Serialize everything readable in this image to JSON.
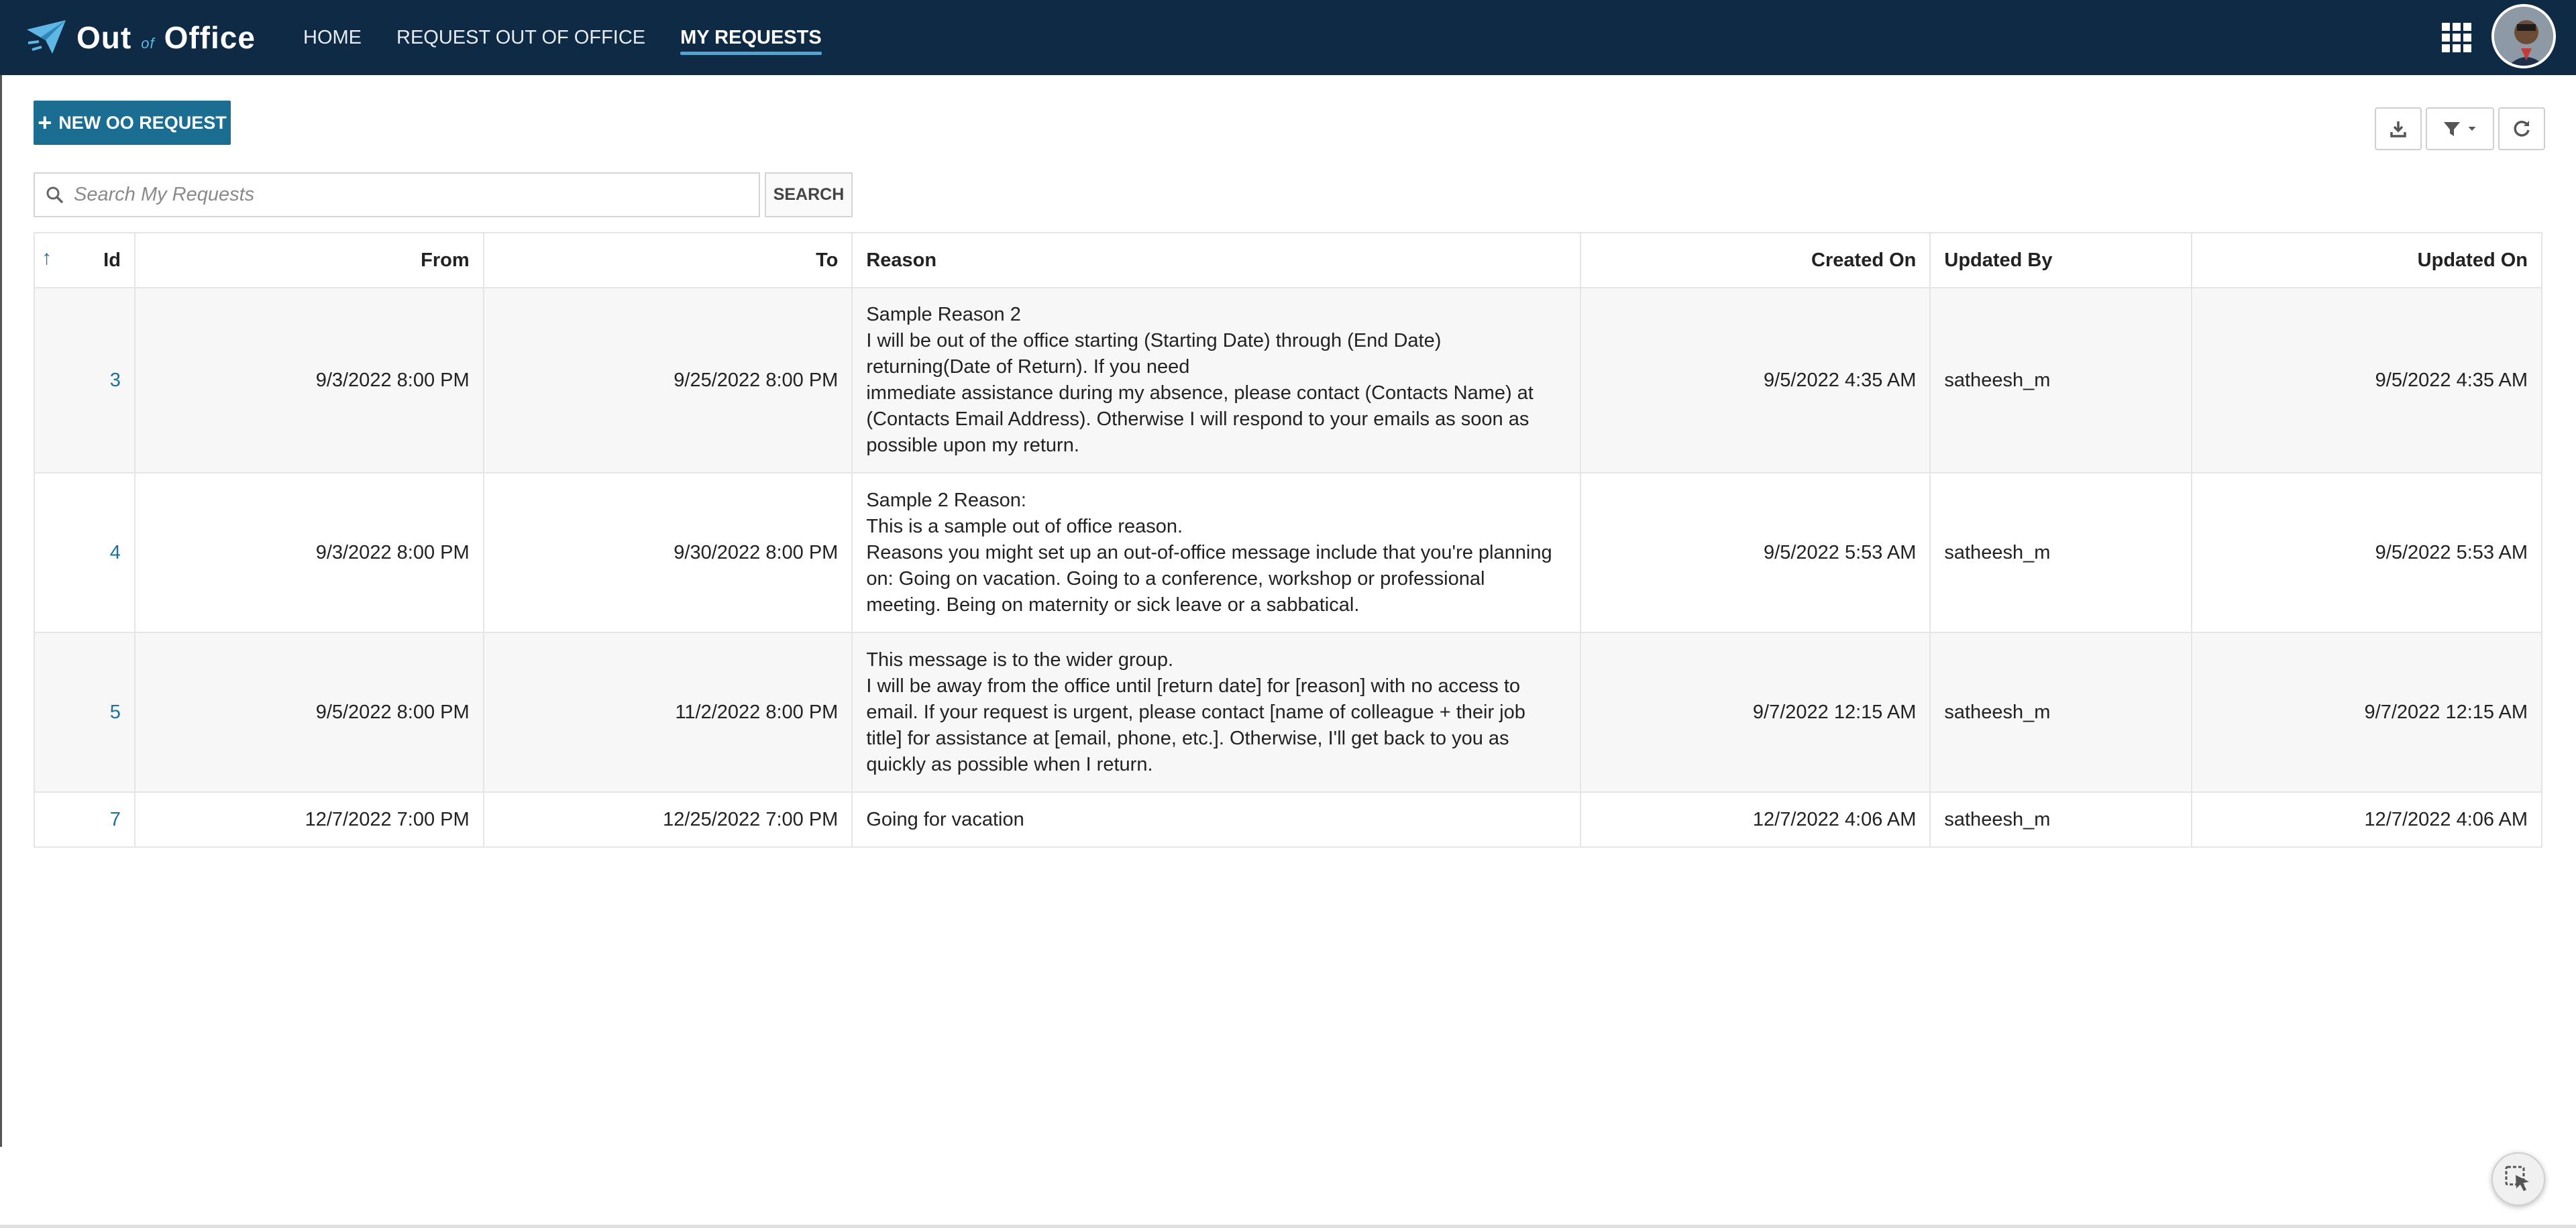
{
  "app": {
    "logo_out": "Out",
    "logo_of": "of",
    "logo_office": "Office"
  },
  "nav": {
    "items": [
      {
        "label": "HOME"
      },
      {
        "label": "REQUEST OUT OF OFFICE"
      },
      {
        "label": "MY REQUESTS"
      }
    ],
    "active_index": 2
  },
  "toolbar": {
    "new_request_label": "NEW OO REQUEST",
    "search_placeholder": "Search My Requests",
    "search_value": "",
    "search_button_label": "SEARCH"
  },
  "table": {
    "columns": [
      "Id",
      "From",
      "To",
      "Reason",
      "Created On",
      "Updated By",
      "Updated On"
    ],
    "rows": [
      {
        "id": "3",
        "from": "9/3/2022 8:00 PM",
        "to": "9/25/2022 8:00 PM",
        "reason_lines": [
          "Sample Reason 2",
          "I will be out of the office starting (Starting Date) through (End Date)",
          "returning(Date of Return). If you need",
          "immediate assistance during my absence, please contact (Contacts Name) at",
          "(Contacts Email Address). Otherwise I will respond to your emails as soon as",
          "possible upon my return."
        ],
        "created_on": "9/5/2022 4:35 AM",
        "updated_by": "satheesh_m",
        "updated_on": "9/5/2022 4:35 AM"
      },
      {
        "id": "4",
        "from": "9/3/2022 8:00 PM",
        "to": "9/30/2022 8:00 PM",
        "reason_lines": [
          "Sample 2 Reason:",
          "This is a sample out of office reason.",
          "Reasons you might set up an out-of-office message include that you're planning",
          "on: Going on vacation. Going to a conference, workshop or professional",
          "meeting. Being on maternity or sick leave or a sabbatical."
        ],
        "created_on": "9/5/2022 5:53 AM",
        "updated_by": "satheesh_m",
        "updated_on": "9/5/2022 5:53 AM"
      },
      {
        "id": "5",
        "from": "9/5/2022 8:00 PM",
        "to": "11/2/2022 8:00 PM",
        "reason_lines": [
          "This message is to the wider group.",
          "I will be away from the office until [return date] for [reason] with no access to",
          "email. If your request is urgent, please contact [name of colleague + their job",
          "title] for assistance at [email, phone, etc.]. Otherwise, I'll get back to you as",
          "quickly as possible when I return."
        ],
        "created_on": "9/7/2022 12:15 AM",
        "updated_by": "satheesh_m",
        "updated_on": "9/7/2022 12:15 AM"
      },
      {
        "id": "7",
        "from": "12/7/2022 7:00 PM",
        "to": "12/25/2022 7:00 PM",
        "reason_lines": [
          "Going for vacation"
        ],
        "created_on": "12/7/2022 4:06 AM",
        "updated_by": "satheesh_m",
        "updated_on": "12/7/2022 4:06 AM"
      }
    ]
  },
  "icons": {
    "logo": "paper-plane-icon",
    "apps": "grid-apps-icon",
    "download": "download-icon",
    "filter": "filter-icon",
    "refresh": "refresh-icon",
    "search": "search-icon",
    "sort": "sort-ascending-icon",
    "cursor": "pointer-select-icon"
  },
  "colors": {
    "navbar": "#0f2a44",
    "primary_button": "#1b6e92",
    "link": "#1f6f9a",
    "row_alt": "#f7f7f7"
  }
}
